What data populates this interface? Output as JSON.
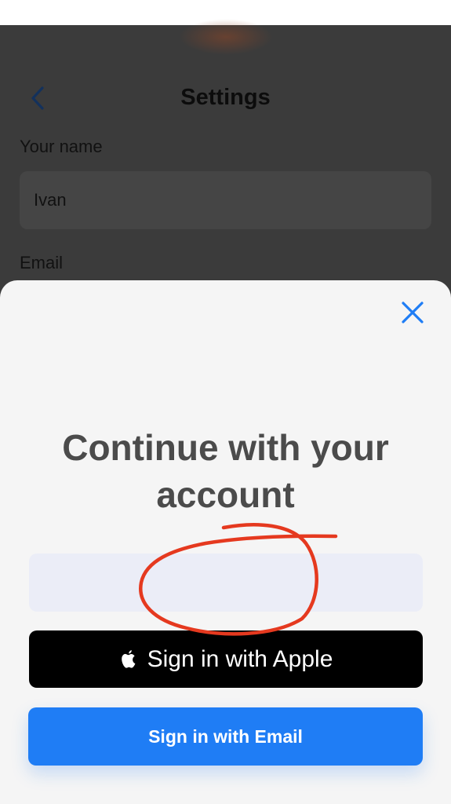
{
  "settings": {
    "title": "Settings",
    "name_label": "Your name",
    "name_value": "Ivan",
    "email_label": "Email",
    "back_icon": "chevron-left-icon"
  },
  "sheet": {
    "close_icon": "close-icon",
    "title": "Continue with your account",
    "apple_button_label": "Sign in with Apple",
    "apple_icon": "apple-logo-icon",
    "email_button_label": "Sign in with Email"
  },
  "colors": {
    "accent": "#1f7df5",
    "overlay": "#3b3b3b",
    "sheet_background": "#f5f5f5",
    "apple_button": "#000000",
    "annotation": "#e5391f"
  }
}
